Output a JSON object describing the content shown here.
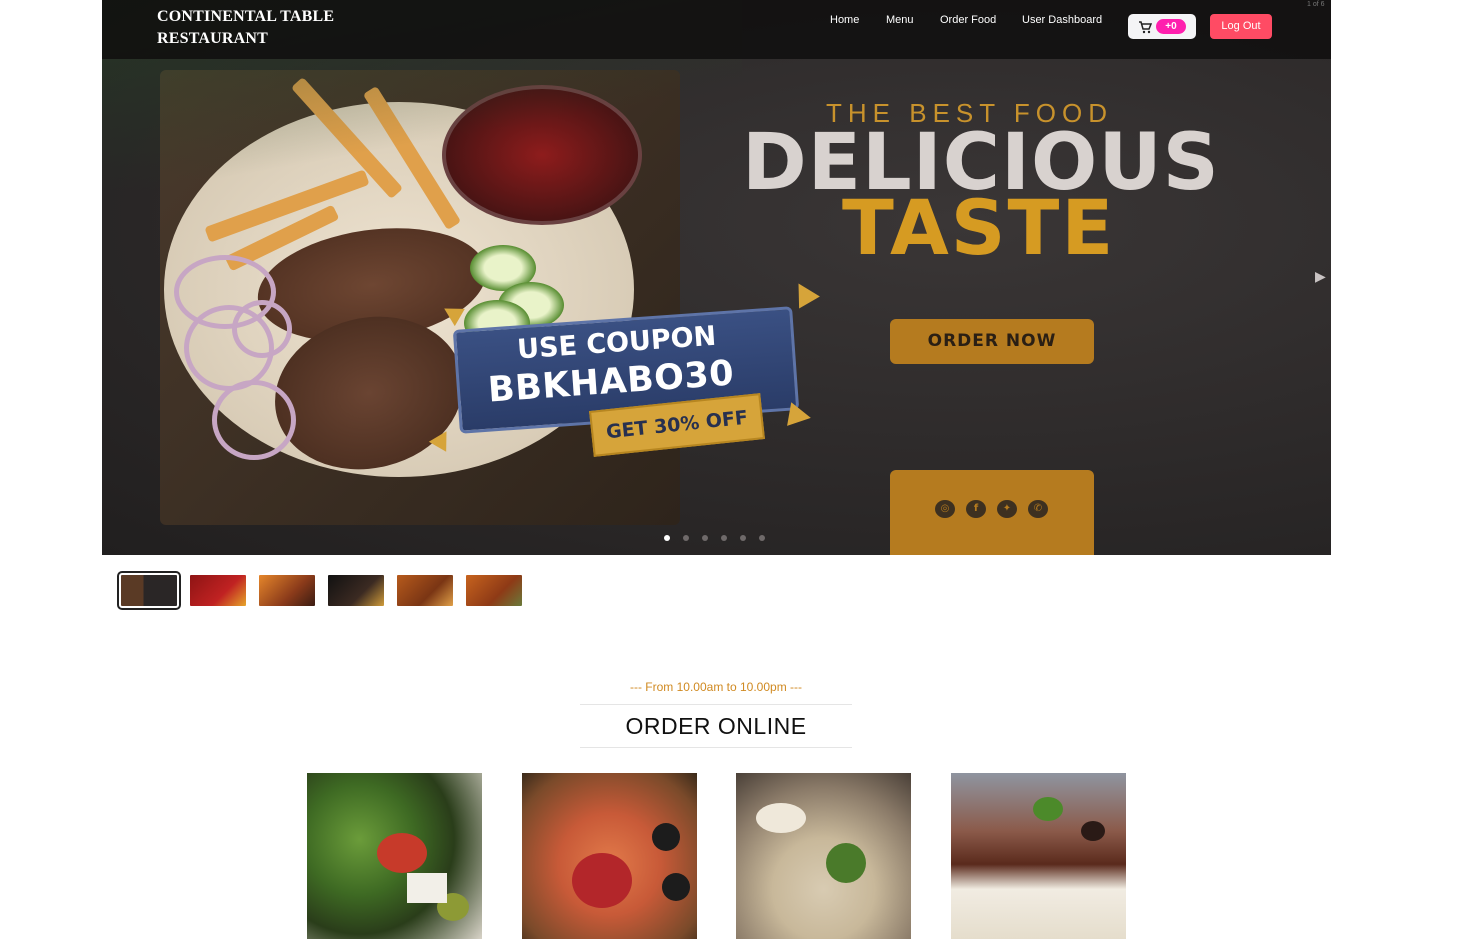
{
  "navbar": {
    "brand_line1": "CONTINENTAL TABLE",
    "brand_line2": "RESTAURANT",
    "links": [
      "Home",
      "Menu",
      "Order Food",
      "User Dashboard"
    ],
    "cart_count": "+0",
    "logout_label": "Log Out"
  },
  "slider": {
    "counter": "1 of 6",
    "slide_count": 6,
    "active_index": 0,
    "hero_subtitle": "THE BEST FOOD",
    "hero_title": "DELICIOUS",
    "hero_accent": "TASTE",
    "order_button": "ORDER NOW",
    "coupon_line1": "USE COUPON",
    "coupon_line2": "BBKHABO30",
    "coupon_offer": "GET 30% OFF",
    "social_icons": [
      "instagram-icon",
      "facebook-icon",
      "twitter-icon",
      "whatsapp-icon"
    ],
    "thumbnail_count": 6
  },
  "order_section": {
    "hours": "--- From 10.00am to 10.00pm ---",
    "title": "ORDER ONLINE",
    "cards": [
      "salad-image",
      "pizza-image",
      "soup-image",
      "cake-image"
    ]
  },
  "colors": {
    "accent": "#c8922c",
    "cart_badge": "#ff1fae",
    "logout": "#ff4b64"
  }
}
